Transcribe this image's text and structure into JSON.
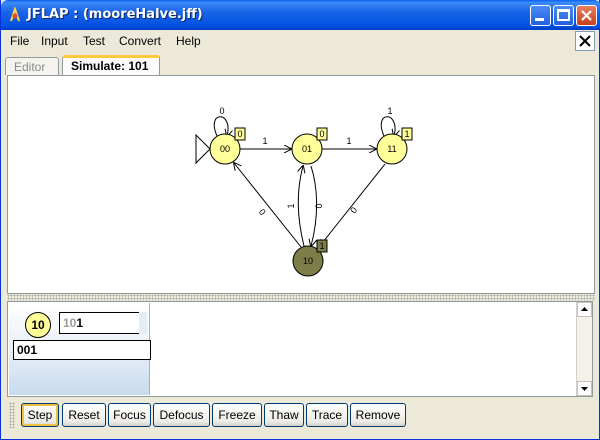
{
  "window": {
    "title": "JFLAP : (mooreHalve.jff)"
  },
  "menu": [
    "File",
    "Input",
    "Test",
    "Convert",
    "Help"
  ],
  "tabs": [
    {
      "label": "Editor",
      "active": false
    },
    {
      "label": "Simulate: 101",
      "active": true
    }
  ],
  "automaton": {
    "states": [
      {
        "name": "00",
        "output": "0",
        "initial": true,
        "highlighted": false
      },
      {
        "name": "01",
        "output": "0",
        "initial": false,
        "highlighted": false
      },
      {
        "name": "11",
        "output": "1",
        "initial": false,
        "highlighted": false
      },
      {
        "name": "10",
        "output": "1",
        "initial": false,
        "highlighted": true
      }
    ],
    "transitions": [
      {
        "from": "00",
        "to": "00",
        "label": "0"
      },
      {
        "from": "00",
        "to": "01",
        "label": "1"
      },
      {
        "from": "01",
        "to": "11",
        "label": "1"
      },
      {
        "from": "11",
        "to": "11",
        "label": "1"
      },
      {
        "from": "10",
        "to": "00",
        "label": "0"
      },
      {
        "from": "10",
        "to": "01",
        "label": "1"
      },
      {
        "from": "01",
        "to": "10",
        "label": "0"
      },
      {
        "from": "11",
        "to": "10",
        "label": "0"
      }
    ]
  },
  "configuration": {
    "state": "10",
    "input_consumed": "10",
    "input_remaining": "1",
    "output": "001"
  },
  "toolbar": [
    "Step",
    "Reset",
    "Focus",
    "Defocus",
    "Freeze",
    "Thaw",
    "Trace",
    "Remove"
  ],
  "colors": {
    "state_fill": "#ffff99",
    "highlight_state_fill": "#7d7d4a",
    "output_box_fill": "#ffff99"
  }
}
